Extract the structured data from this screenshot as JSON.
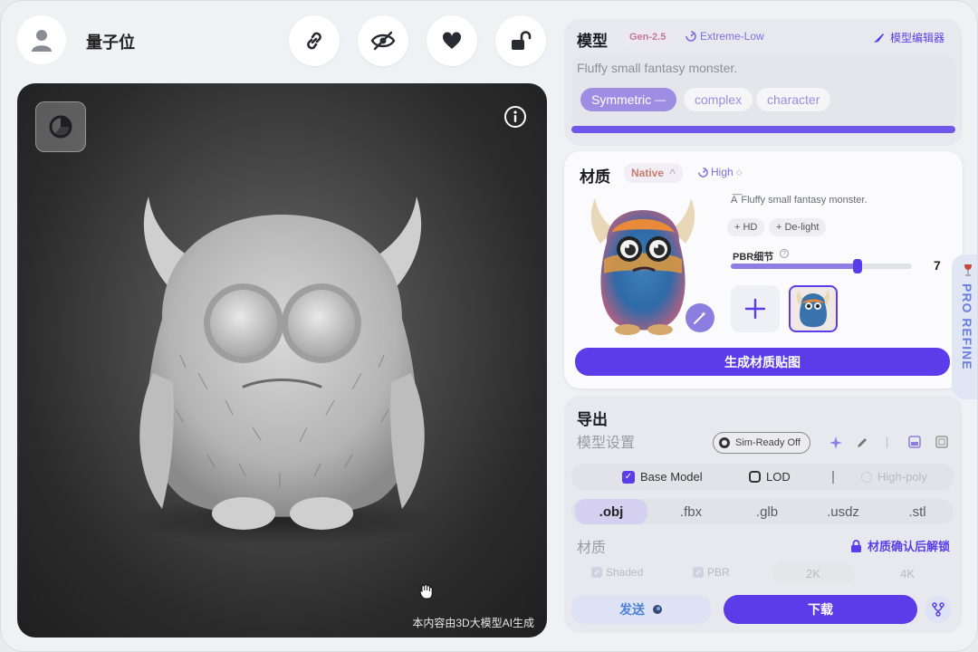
{
  "user": {
    "name": "量子位"
  },
  "toolbar": {
    "icons": [
      "link-icon",
      "eye-icon",
      "heart-icon",
      "unlock-icon"
    ]
  },
  "viewport": {
    "caption": "本内容由3D大模型AI生成"
  },
  "model_panel": {
    "title": "模型",
    "version_badge": "Gen-2.5",
    "quality_badge": "Extreme-Low",
    "editor_label": "模型编辑器",
    "prompt": "Fluffy small fantasy monster.",
    "tags": [
      "Symmetric",
      "complex",
      "character"
    ]
  },
  "material_panel": {
    "title": "材质",
    "mode_badge": "Native",
    "quality_badge": "High",
    "prompt": "Fluffy small fantasy monster.",
    "options": [
      "+ HD",
      "+ De-light"
    ],
    "pbr_label": "PBR细节",
    "pbr_value": "7",
    "pbr_fraction": 0.7,
    "generate_label": "生成材质贴图"
  },
  "export_panel": {
    "title": "导出",
    "model_settings_label": "模型设置",
    "sim_ready_label": "Sim-Ready Off",
    "base_model_label": "Base Model",
    "lod_label": "LOD",
    "high_poly_label": "High-poly",
    "formats": [
      ".obj",
      ".fbx",
      ".glb",
      ".usdz",
      ".stl"
    ],
    "material_label": "材质",
    "lock_label": "材质确认后解锁",
    "material_options": [
      "Shaded",
      "PBR",
      "2K",
      "4K"
    ],
    "send_label": "发送",
    "download_label": "下载"
  },
  "pro_refine": {
    "label": "PRO REFINE"
  },
  "colors": {
    "accent": "#5a3de8",
    "background": "#f0f1f4"
  }
}
